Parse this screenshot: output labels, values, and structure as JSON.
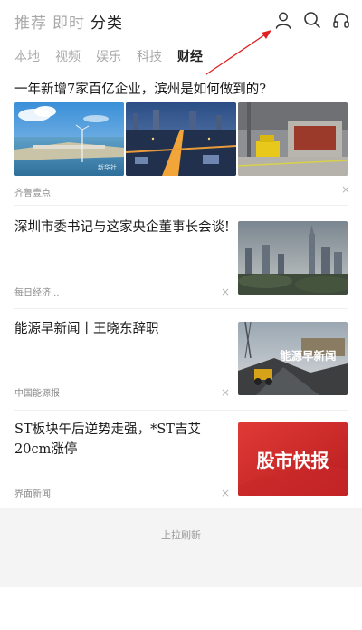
{
  "top_tabs": [
    {
      "label": "推荐"
    },
    {
      "label": "即时"
    },
    {
      "label": "分类",
      "active": true
    }
  ],
  "header_icons": [
    "user-icon",
    "search-icon",
    "headphones-icon"
  ],
  "categories": [
    {
      "label": "本地"
    },
    {
      "label": "视频"
    },
    {
      "label": "娱乐"
    },
    {
      "label": "科技"
    },
    {
      "label": "财经",
      "active": true
    }
  ],
  "feed": [
    {
      "title": "一年新增7家百亿企业，滨州是如何做到的?",
      "source": "齐鲁壹点",
      "image_text": "新华社"
    },
    {
      "title": "深圳市委书记与这家央企董事长会谈!",
      "source": "每日经济..."
    },
    {
      "title": "能源早新闻丨王晓东辞职",
      "source": "中国能源报",
      "image_text": "能源早新闻"
    },
    {
      "title": "ST板块午后逆势走强，*ST吉艾20cm涨停",
      "source": "界面新闻",
      "image_text": "股市快报"
    }
  ],
  "close_glyph": "×",
  "pull_refresh": "上拉刷新",
  "colors": {
    "arrow": "#e02020",
    "accent_red": "#d8282a"
  }
}
